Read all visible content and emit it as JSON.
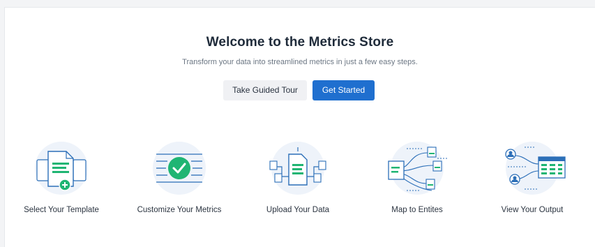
{
  "header": {
    "title": "Welcome to the Metrics Store",
    "subtitle": "Transform your data into streamlined metrics in just a few easy steps."
  },
  "actions": {
    "tour_label": "Take Guided Tour",
    "start_label": "Get Started"
  },
  "steps": [
    {
      "label": "Select Your Template",
      "icon": "template-icon"
    },
    {
      "label": "Customize Your Metrics",
      "icon": "customize-check-icon"
    },
    {
      "label": "Upload Your Data",
      "icon": "upload-data-icon"
    },
    {
      "label": "Map to Entites",
      "icon": "map-entities-icon"
    },
    {
      "label": "View Your Output",
      "icon": "output-table-icon"
    }
  ],
  "colors": {
    "accent": "#1f6fcf",
    "success": "#1fb573",
    "illustration_blue": "#2c6fb8",
    "illustration_bg": "#eef3fa"
  }
}
